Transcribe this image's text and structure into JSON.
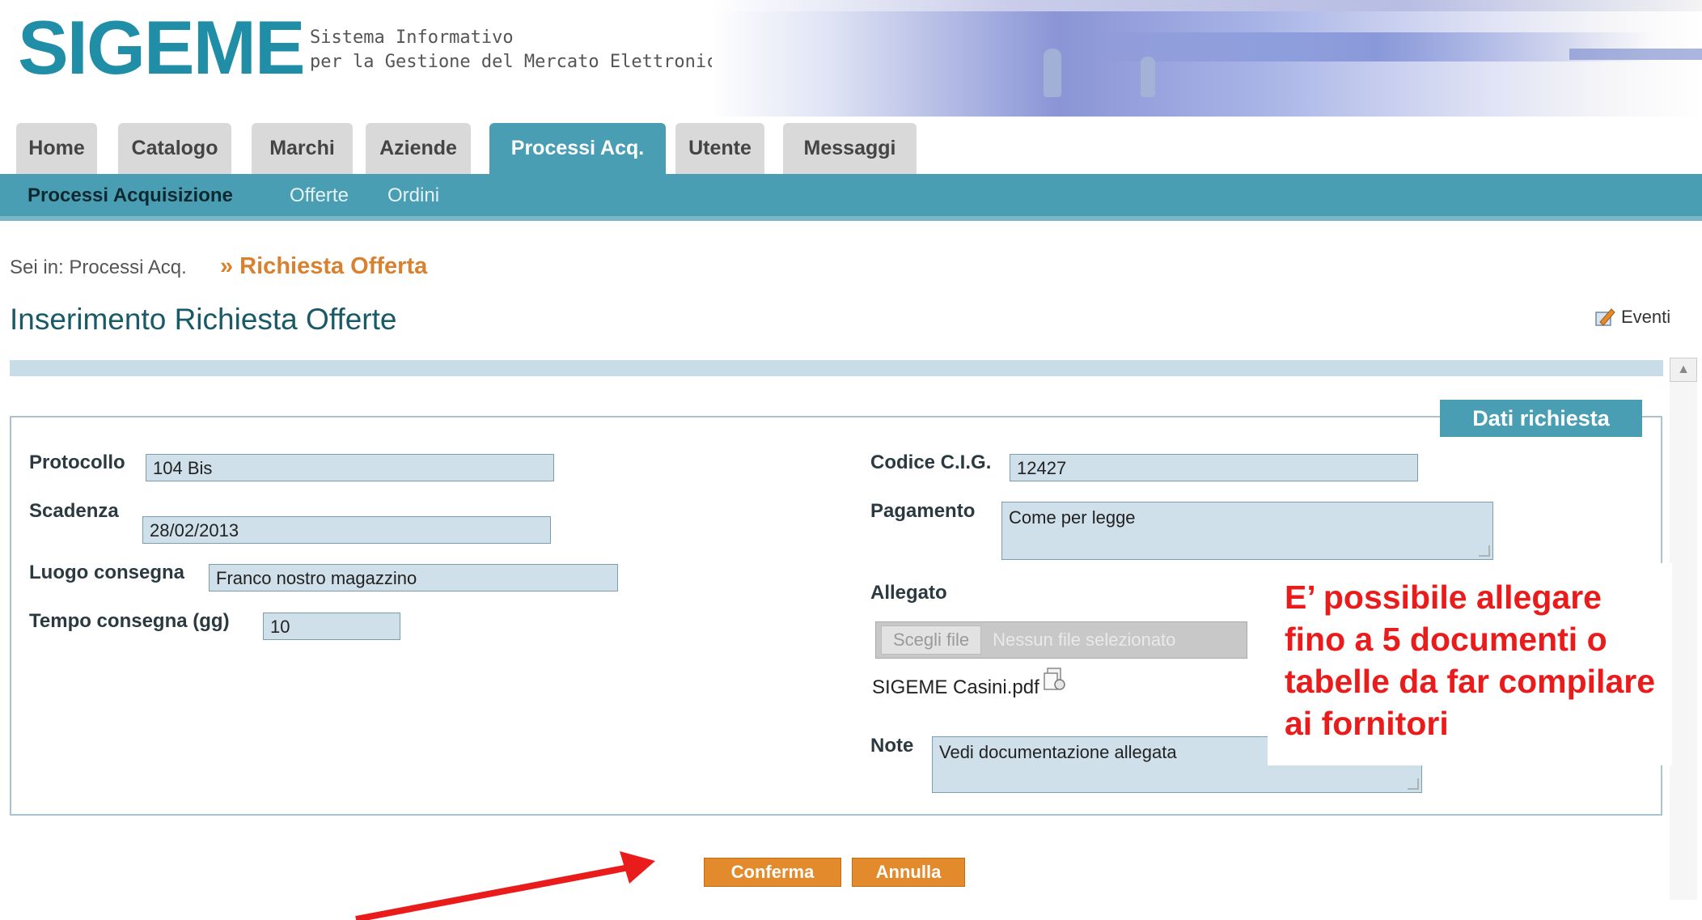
{
  "header": {
    "logo": "SIGEME",
    "subtitle_line1": "Sistema Informativo",
    "subtitle_line2": "per la Gestione del Mercato Elettronico"
  },
  "tabs": [
    {
      "label": "Home"
    },
    {
      "label": "Catalogo"
    },
    {
      "label": "Marchi"
    },
    {
      "label": "Aziende"
    },
    {
      "label": "Processi Acq."
    },
    {
      "label": "Utente"
    },
    {
      "label": "Messaggi"
    }
  ],
  "active_tab": "Processi Acq.",
  "subnav": [
    "Processi Acquisizione",
    "Offerte",
    "Ordini"
  ],
  "breadcrumb": {
    "prefix": "Sei in: Processi Acq.",
    "current": "» Richiesta Offerta"
  },
  "page_title": "Inserimento Richiesta Offerte",
  "eventi_label": "Eventi",
  "form": {
    "legend": "Dati richiesta",
    "protocollo": {
      "label": "Protocollo",
      "value": "104 Bis"
    },
    "scadenza": {
      "label": "Scadenza",
      "value": "28/02/2013"
    },
    "luogo": {
      "label": "Luogo consegna",
      "value": "Franco nostro magazzino"
    },
    "tempo": {
      "label": "Tempo consegna (gg)",
      "value": "10"
    },
    "cig": {
      "label": "Codice C.I.G.",
      "value": "12427"
    },
    "pagamento": {
      "label": "Pagamento",
      "value": "Come per legge"
    },
    "allegato": {
      "label": "Allegato",
      "button": "Scegli file",
      "status": "Nessun file selezionato",
      "file": "SIGEME Casini.pdf"
    },
    "note": {
      "label": "Note",
      "value": "Vedi documentazione allegata"
    }
  },
  "annotation": "E’ possibile allegare fino a 5 documenti o tabelle da far compilare ai fornitori",
  "buttons": {
    "confirm": "Conferma",
    "cancel": "Annulla"
  },
  "colors": {
    "brand": "#1f8ea6",
    "nav": "#4a9eb4",
    "field": "#cfe0ea",
    "button": "#e38a2c",
    "annotation": "#ea1b1b"
  }
}
